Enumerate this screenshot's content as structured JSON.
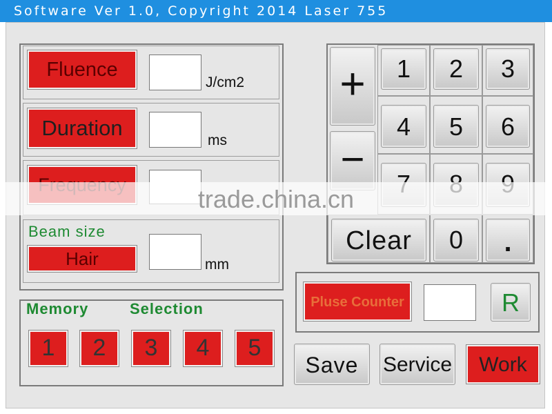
{
  "title": "Software Ver 1.0, Copyright 2014 Laser 755",
  "params": {
    "fluence": {
      "label": "Fluence",
      "value": "",
      "unit": "J/cm2"
    },
    "duration": {
      "label": "Duration",
      "value": "",
      "unit": "ms"
    },
    "frequency": {
      "label": "Frequency",
      "value": ""
    },
    "beam": {
      "caption": "Beam size",
      "label": "Hair",
      "value": "",
      "unit": "mm"
    }
  },
  "memory": {
    "label1": "Memory",
    "label2": "Selection",
    "slots": [
      "1",
      "2",
      "3",
      "4",
      "5"
    ]
  },
  "keypad": {
    "plus": "+",
    "minus": "−",
    "keys": [
      "1",
      "2",
      "3",
      "4",
      "5",
      "6",
      "7",
      "8",
      "9"
    ],
    "clear": "Clear",
    "zero": "0",
    "dot": "."
  },
  "counter": {
    "label": "Pluse Counter",
    "value": "",
    "reset": "R"
  },
  "actions": {
    "save": "Save",
    "service": "Service",
    "work": "Work"
  },
  "watermark": "trade.china.cn",
  "colors": {
    "red": "#dd1e1e",
    "green": "#1e8a32",
    "titlebar": "#1f8fe0",
    "panel": "#e6e6e6"
  }
}
